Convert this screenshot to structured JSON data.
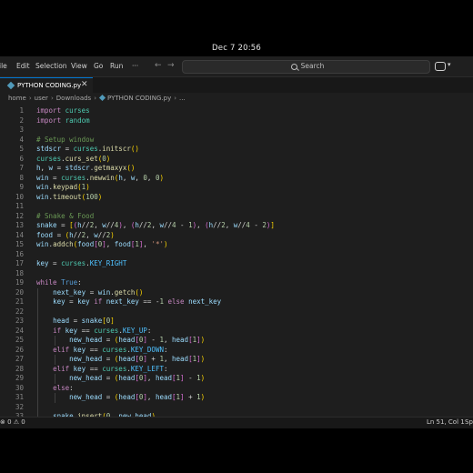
{
  "system": {
    "clock": "Dec 7  20:56"
  },
  "menubar": {
    "items": [
      "ile",
      "Edit",
      "Selection",
      "View",
      "Go",
      "Run",
      "···"
    ],
    "back_icon": "arrow-left-icon",
    "forward_icon": "arrow-right-icon",
    "search_label": "Search"
  },
  "tab": {
    "label": "PYTHON CODING.py",
    "close": "✕"
  },
  "breadcrumb": {
    "parts": [
      "home",
      "user",
      "Downloads",
      "PYTHON CODING.py",
      "..."
    ]
  },
  "editor": {
    "line_numbers": [
      "1",
      "2",
      "3",
      "4",
      "5",
      "6",
      "7",
      "8",
      "9",
      "10",
      "11",
      "12",
      "13",
      "14",
      "15",
      "16",
      "17",
      "18",
      "19",
      "20",
      "21",
      "22",
      "23",
      "24",
      "25",
      "26",
      "27",
      "28",
      "29",
      "30",
      "31",
      "32",
      "33"
    ],
    "lines": [
      "import curses",
      "import random",
      "",
      "# Setup window",
      "stdscr = curses.initscr()",
      "curses.curs_set(0)",
      "h, w = stdscr.getmaxyx()",
      "win = curses.newwin(h, w, 0, 0)",
      "win.keypad(1)",
      "win.timeout(100)",
      "",
      "# Snake & Food",
      "snake = [(h//2, w//4), (h//2, w//4 - 1), (h//2, w//4 - 2)]",
      "food = (h//2, w//2)",
      "win.addch(food[0], food[1], '*')",
      "",
      "key = curses.KEY_RIGHT",
      "",
      "while True:",
      "    next_key = win.getch()",
      "    key = key if next_key == -1 else next_key",
      "",
      "    head = snake[0]",
      "    if key == curses.KEY_UP:",
      "        new_head = (head[0] - 1, head[1])",
      "    elif key == curses.KEY_DOWN:",
      "        new_head = (head[0] + 1, head[1])",
      "    elif key == curses.KEY_LEFT:",
      "        new_head = (head[0], head[1] - 1)",
      "    else:",
      "        new_head = (head[0], head[1] + 1)",
      "",
      "    snake.insert(0, new_head)"
    ]
  },
  "statusbar": {
    "problems": "⊗ 0 ⚠ 0",
    "position": "Ln 51, Col 1",
    "spaces": "Sp"
  },
  "colors": {
    "keyword": "#c586c0",
    "module": "#4ec9b0",
    "function": "#dcdcaa",
    "variable": "#9cdcfe",
    "number": "#b5cea8",
    "comment": "#6a9955",
    "accent": "#0078d4"
  }
}
